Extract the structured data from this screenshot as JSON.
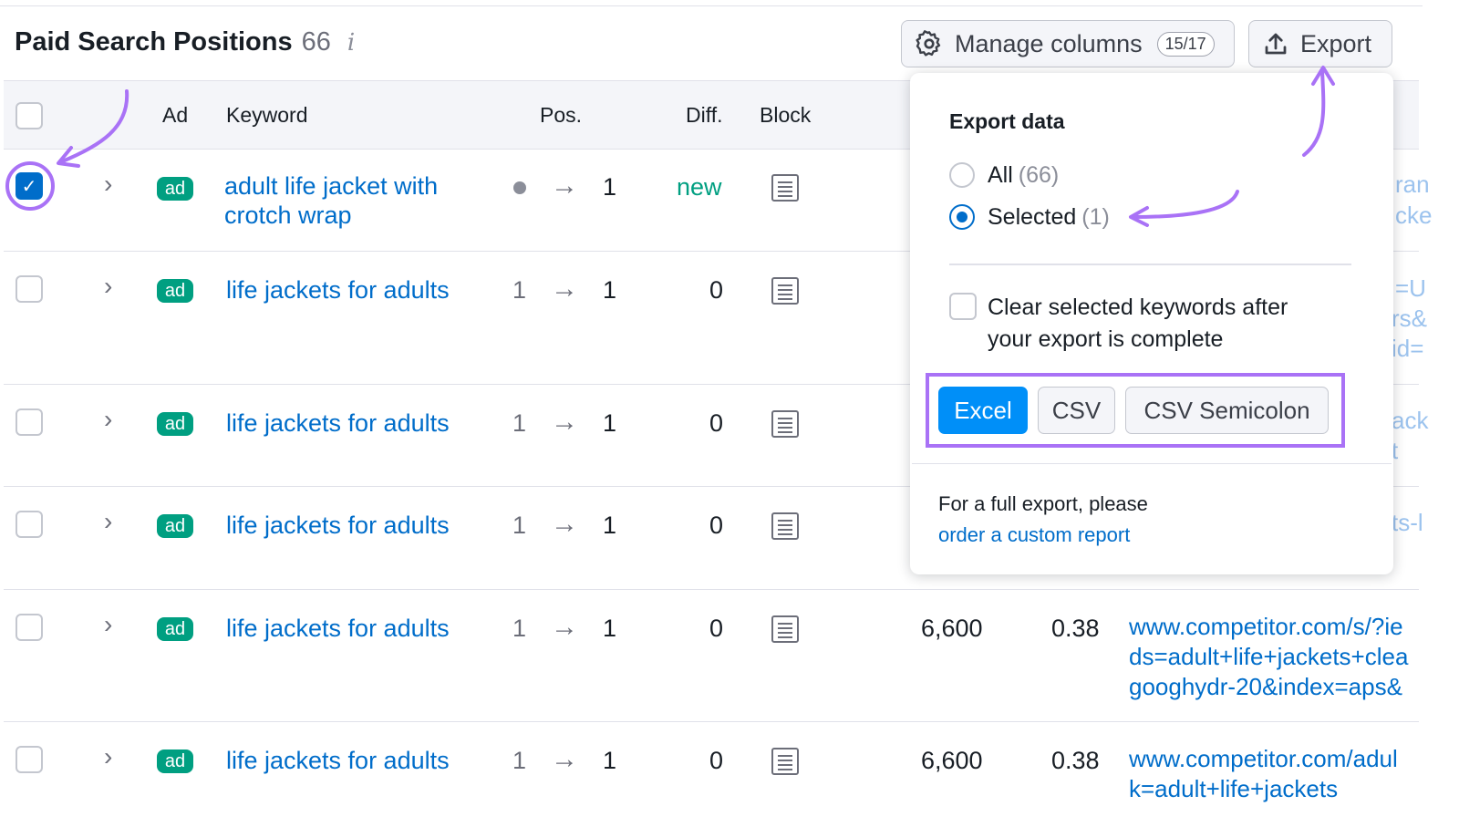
{
  "header": {
    "title": "Paid Search Positions",
    "count": "66",
    "info": "i"
  },
  "toolbar": {
    "manage_label": "Manage columns",
    "manage_badge": "15/17",
    "export_label": "Export"
  },
  "table": {
    "columns": [
      "Ad",
      "Keyword",
      "Pos.",
      "Diff.",
      "Block"
    ],
    "rows": [
      {
        "ad": "ad",
        "keyword": "adult life jacket with crotch wrap",
        "pos_from": "",
        "pos_to": "1",
        "diff": "new",
        "volume": "",
        "cpc": "",
        "url": "",
        "url_fragments": [
          "ran",
          "cke"
        ]
      },
      {
        "ad": "ad",
        "keyword": "life jackets for adults",
        "pos_from": "1",
        "pos_to": "1",
        "diff": "0",
        "volume": "",
        "cpc": "",
        "url": "",
        "url_fragments": [
          "=U",
          "rs&",
          "id="
        ]
      },
      {
        "ad": "ad",
        "keyword": "life jackets for adults",
        "pos_from": "1",
        "pos_to": "1",
        "diff": "0",
        "volume": "",
        "cpc": "",
        "url": "",
        "url_fragments": [
          "ack",
          "t"
        ]
      },
      {
        "ad": "ad",
        "keyword": "life jackets for adults",
        "pos_from": "1",
        "pos_to": "1",
        "diff": "0",
        "volume": "",
        "cpc": "",
        "url": "",
        "url_fragments": [
          "ts-l"
        ]
      },
      {
        "ad": "ad",
        "keyword": "life jackets for adults",
        "pos_from": "1",
        "pos_to": "1",
        "diff": "0",
        "volume": "6,600",
        "cpc": "0.38",
        "url_lines": [
          "www.competitor.com/s/?ie",
          "ds=adult+life+jackets+clea",
          "googhydr-20&index=aps&"
        ]
      },
      {
        "ad": "ad",
        "keyword": "life jackets for adults",
        "pos_from": "1",
        "pos_to": "1",
        "diff": "0",
        "volume": "6,600",
        "cpc": "0.38",
        "url_lines": [
          "www.competitor.com/adul",
          "k=adult+life+jackets"
        ]
      }
    ]
  },
  "export_popup": {
    "title": "Export data",
    "option_all": "All",
    "option_all_count": "(66)",
    "option_selected": "Selected",
    "option_selected_count": "(1)",
    "clear_label": "Clear selected keywords after your export is complete",
    "formats": [
      "Excel",
      "CSV",
      "CSV Semicolon"
    ],
    "footer_text": "For a full export, please",
    "footer_link": "order a custom report"
  },
  "icons": {
    "gear": "gear-icon",
    "export": "upload-icon",
    "chevron": "chevron-right-icon",
    "arrow": "arrow-right-icon",
    "block": "document-icon",
    "check": "checkmark-icon"
  },
  "colors": {
    "accent": "#006dca",
    "annotation": "#a972f6",
    "ad_badge": "#009f81",
    "primary_button": "#008ff8"
  }
}
